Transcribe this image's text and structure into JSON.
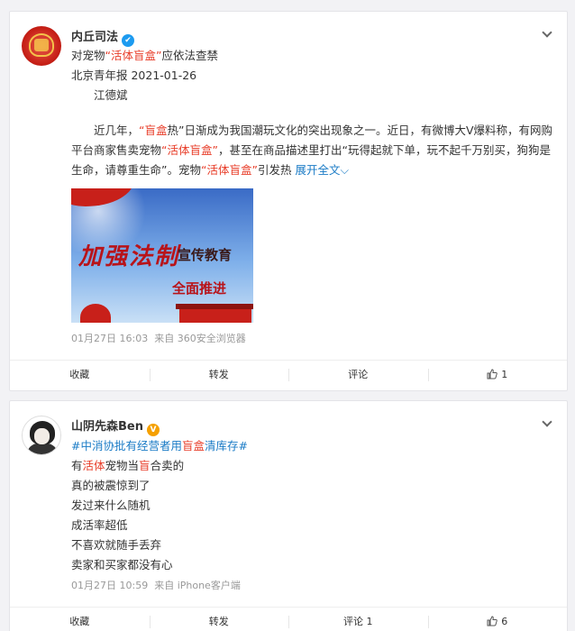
{
  "post1": {
    "username": "内丘司法",
    "verified_mark": "✔",
    "title_prefix": "对宠物",
    "title_highlight": "“活体盲盒”",
    "title_suffix": "应依法查禁",
    "source": "北京青年报 2021-01-26",
    "author": "江德斌",
    "body": {
      "p1": "近几年，",
      "p1_hl": "“盲盒",
      "p2": "热”日渐成为我国潮玩文化的突出现象之一。近日，有微博大V爆料称，有网购",
      "line2a": "平台商家售卖宠物",
      "line2_hl": "“活体盲盒”",
      "line2b": "，甚至在商品描述里打出“玩得起就下单，玩不起千万别买，狗狗是",
      "line3a": "生命，请尊重生命”。宠物",
      "line3_hl": "“活体盲盒”",
      "line3b": "引发热",
      "expand": "展开全文",
      "expand_icon": "chevron-down"
    },
    "image": {
      "text1": "加强法制",
      "text2": "宣传教育",
      "text3": "全面推进"
    },
    "time": "01月27日 16:03",
    "client": "来自 360安全浏览器",
    "actions": {
      "collect": "收藏",
      "forward": "转发",
      "comment": "评论",
      "like_count": "1"
    }
  },
  "post2": {
    "username": "山阴先森Ben",
    "verified_mark": "V",
    "hashtag_a": "#中消协批有经营者用",
    "hashtag_hl": "盲盒",
    "hashtag_b": "清库存#",
    "line1a": "有",
    "line1_hl1": "活体",
    "line1b": "宠物当",
    "line1_hl2": "盲",
    "line1c": "合卖的",
    "line2": "真的被震惊到了",
    "line3": "发过来什么随机",
    "line4": "成活率超低",
    "line5": "不喜欢就随手丢弃",
    "line6": "卖家和买家都没有心",
    "time": "01月27日 10:59",
    "client": "来自 iPhone客户端",
    "actions": {
      "collect": "收藏",
      "forward": "转发",
      "comment": "评论 1",
      "like_count": "6"
    }
  },
  "colors": {
    "highlight": "#e83e2a",
    "link": "#1a7bc6",
    "verified_blue": "#1d9bf0",
    "verified_gold": "#f5a000"
  }
}
